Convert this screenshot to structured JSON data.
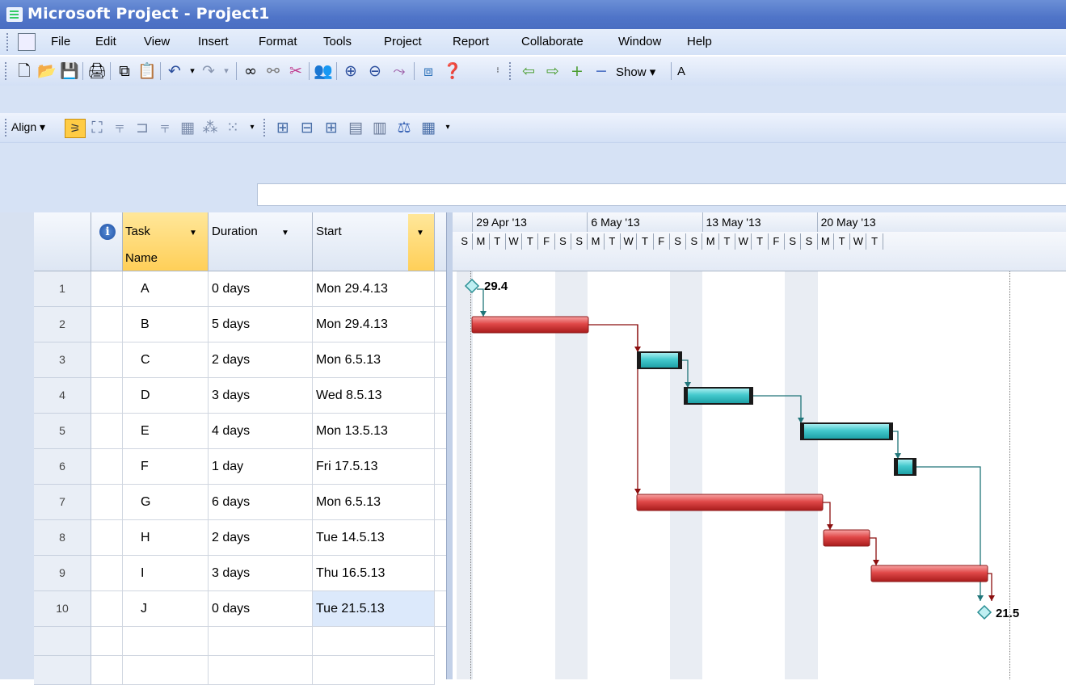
{
  "window": {
    "title": "Microsoft Project - Project1"
  },
  "menu": [
    "File",
    "Edit",
    "View",
    "Insert",
    "Format",
    "Tools",
    "Project",
    "Report",
    "Collaborate",
    "Window",
    "Help"
  ],
  "toolbar": {
    "show_label": "Show ▾",
    "align_label": "Align ▾",
    "cut_off_text": "A"
  },
  "grid": {
    "headers": {
      "info": "i",
      "task_name_line1": "Task",
      "task_name_line2": "Name",
      "duration": "Duration",
      "start": "Start"
    },
    "rows": [
      {
        "id": "1",
        "name": "A",
        "duration": "0 days",
        "start": "Mon 29.4.13"
      },
      {
        "id": "2",
        "name": "B",
        "duration": "5 days",
        "start": "Mon 29.4.13"
      },
      {
        "id": "3",
        "name": "C",
        "duration": "2 days",
        "start": "Mon 6.5.13"
      },
      {
        "id": "4",
        "name": "D",
        "duration": "3 days",
        "start": "Wed 8.5.13"
      },
      {
        "id": "5",
        "name": "E",
        "duration": "4 days",
        "start": "Mon 13.5.13"
      },
      {
        "id": "6",
        "name": "F",
        "duration": "1 day",
        "start": "Fri 17.5.13"
      },
      {
        "id": "7",
        "name": "G",
        "duration": "6 days",
        "start": "Mon 6.5.13"
      },
      {
        "id": "8",
        "name": "H",
        "duration": "2 days",
        "start": "Tue 14.5.13"
      },
      {
        "id": "9",
        "name": "I",
        "duration": "3 days",
        "start": "Thu 16.5.13"
      },
      {
        "id": "10",
        "name": "J",
        "duration": "0 days",
        "start": "Tue 21.5.13"
      }
    ]
  },
  "timescale": {
    "weeks": [
      "29 Apr '13",
      "6 May '13",
      "13 May '13",
      "20 May '13"
    ],
    "days": [
      "S",
      "M",
      "T",
      "W",
      "T",
      "F",
      "S",
      "S",
      "M",
      "T",
      "W",
      "T",
      "F",
      "S",
      "S",
      "M",
      "T",
      "W",
      "T",
      "F",
      "S",
      "S",
      "M",
      "T",
      "W",
      "T"
    ]
  },
  "gantt": {
    "milestone_labels": {
      "start": "29.4",
      "end": "21.5"
    },
    "critical_color": "#d63a3a",
    "noncritical_color": "#35c1c6"
  }
}
